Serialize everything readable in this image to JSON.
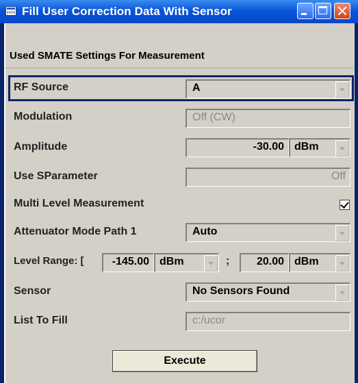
{
  "window": {
    "title": "Fill User Correction Data With Sensor"
  },
  "heading": "Used SMATE Settings For Measurement",
  "rf_source": {
    "label": "RF Source",
    "value": "A"
  },
  "modulation": {
    "label": "Modulation",
    "value": "Off (CW)"
  },
  "amplitude": {
    "label": "Amplitude",
    "value": "-30.00",
    "unit": "dBm"
  },
  "sparameter": {
    "label": "Use SParameter",
    "value": "Off"
  },
  "multi_level": {
    "label": "Multi Level Measurement",
    "checked": true
  },
  "attenuator": {
    "label": "Attenuator Mode Path 1",
    "value": "Auto"
  },
  "level_range": {
    "label": "Level Range: [",
    "min": "-145.00",
    "min_unit": "dBm",
    "separator": ";",
    "max": "20.00",
    "max_unit": "dBm"
  },
  "sensor": {
    "label": "Sensor",
    "value": "No Sensors Found"
  },
  "list_to_fill": {
    "label": "List To Fill",
    "value": "c:/ucor"
  },
  "execute_label": "Execute"
}
